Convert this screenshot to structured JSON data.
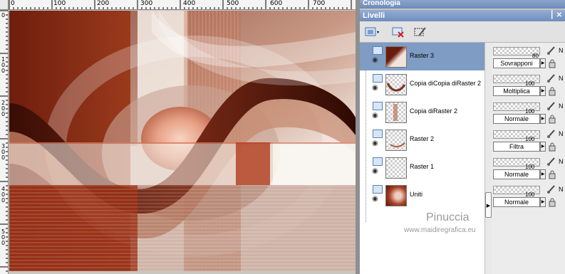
{
  "panels": {
    "history_title": "Cronologia",
    "layers_title": "Livelli"
  },
  "ruler": {
    "top_labels": [
      "0",
      "100",
      "200",
      "300",
      "400",
      "500",
      "600",
      "700"
    ],
    "left_labels": [
      "0",
      "1 0 0",
      "2 0 0",
      "3 0 0",
      "4 0 0",
      "5 0 0"
    ]
  },
  "layers": [
    {
      "name": "Raster 3",
      "opacity": "80",
      "blend": "Sovrapponi",
      "selected": true
    },
    {
      "name": "Copia diCopia diRaster 2",
      "opacity": "100",
      "blend": "Moltiplica",
      "selected": false
    },
    {
      "name": "Copia diRaster 2",
      "opacity": "100",
      "blend": "Normale",
      "selected": false
    },
    {
      "name": "Raster 2",
      "opacity": "100",
      "blend": "Filtra",
      "selected": false
    },
    {
      "name": "Raster 1",
      "opacity": "100",
      "blend": "Normale",
      "selected": false
    },
    {
      "name": "Uniti",
      "opacity": "100",
      "blend": "Normale",
      "selected": false
    }
  ],
  "watermark": {
    "name": "Pinuccia",
    "site": "www.maidiregrafica.eu"
  },
  "colors": {
    "accent": "#7f9cc4",
    "artwork_dark": "#7a2210",
    "artwork_light": "#f4efe9"
  }
}
